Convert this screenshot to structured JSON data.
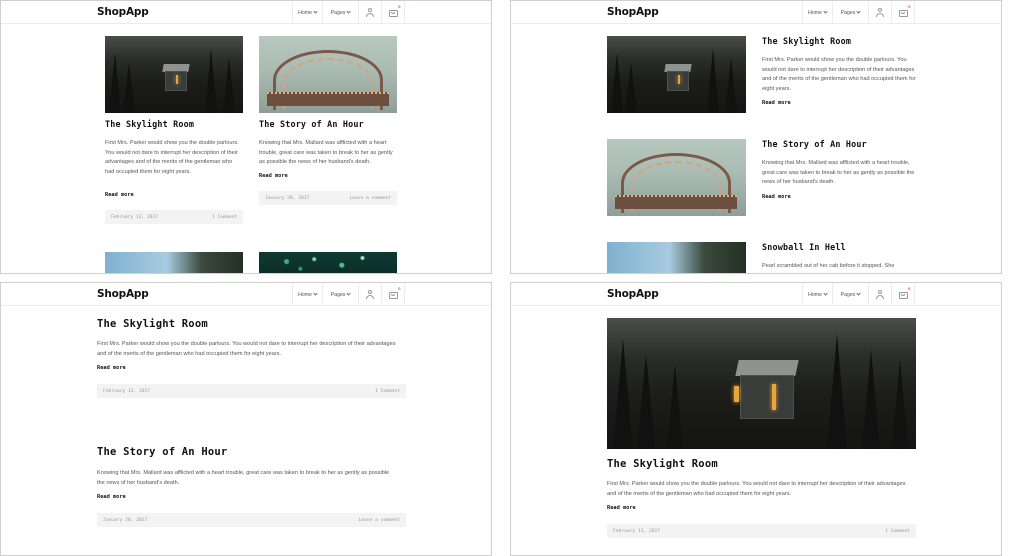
{
  "nav": {
    "logo": "ShopApp",
    "home_label": "Home",
    "pages_label": "Pages",
    "cart_count": "0",
    "icons": [
      "user-icon",
      "cart-icon",
      "chevron-down-icon"
    ]
  },
  "posts": {
    "skylight": {
      "title": "The Skylight Room",
      "excerpt": "First Mrs. Parker would show you the double parlours. You would not dare to interrupt her description of their advantages and of the merits of the gentleman who had occupied them for eight years.",
      "read_more": "Read more",
      "date": "February 13, 2017",
      "comments": "1 Comment"
    },
    "story": {
      "title": "The Story of An Hour",
      "excerpt": "Knowing that Mrs. Mallard was afflicted with a heart trouble, great care was taken to break to her as gently as possible the news of her husband's death.",
      "read_more": "Read more",
      "date": "January 20, 2017",
      "comments": "Leave a comment"
    },
    "snowball": {
      "title": "Snowball In Hell",
      "excerpt": "Pearl scrambled out of her cab before it stopped. She"
    }
  },
  "colors": {
    "accent_badge": "#e23d3d",
    "meta_bg": "#f3f3f3"
  }
}
